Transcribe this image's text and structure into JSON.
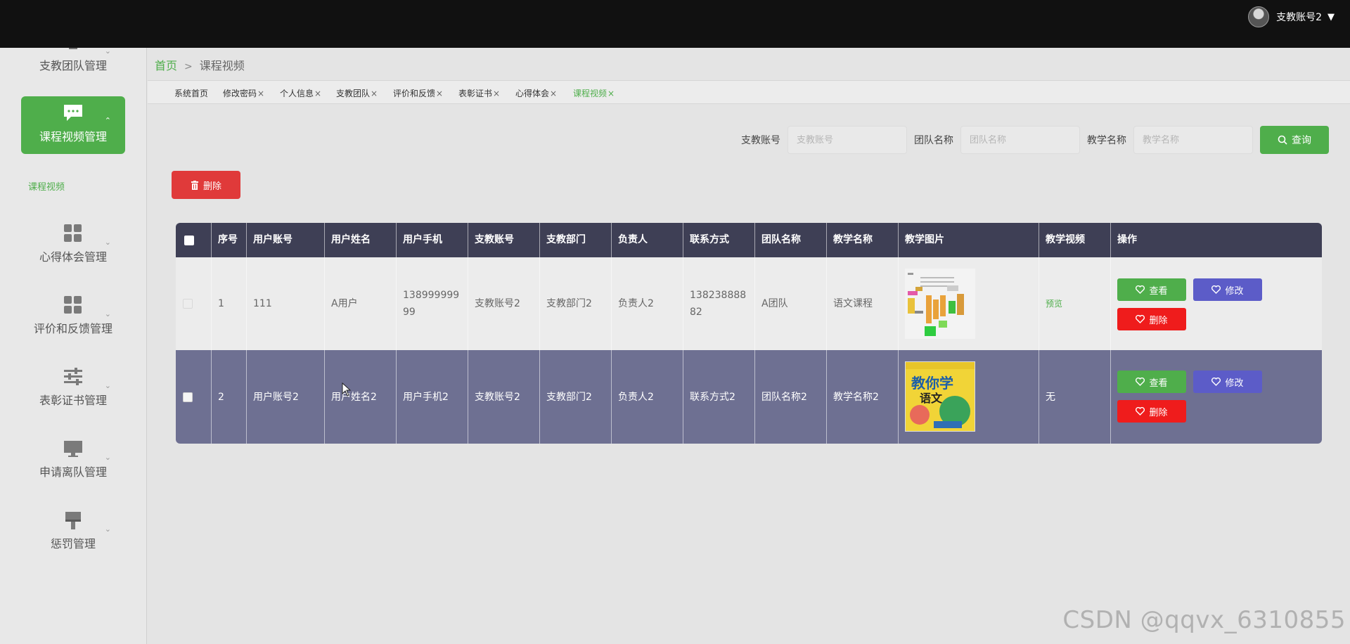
{
  "header": {
    "username": "支教账号2",
    "caret": "▼"
  },
  "sidebar": {
    "items": [
      {
        "label": "支教团队管理",
        "icon": "team-icon"
      },
      {
        "label": "课程视频管理",
        "icon": "chat-icon",
        "active": true
      },
      {
        "label": "心得体会管理",
        "icon": "grid-icon"
      },
      {
        "label": "评价和反馈管理",
        "icon": "grid-icon"
      },
      {
        "label": "表彰证书管理",
        "icon": "sliders-icon"
      },
      {
        "label": "申请离队管理",
        "icon": "monitor-icon"
      },
      {
        "label": "惩罚管理",
        "icon": "brush-icon"
      }
    ],
    "sub_item": "课程视频"
  },
  "breadcrumb": {
    "home": "首页",
    "separator": ">",
    "current": "课程视频"
  },
  "tags": [
    {
      "label": "系统首页",
      "close": ""
    },
    {
      "label": "修改密码",
      "close": "×"
    },
    {
      "label": "个人信息",
      "close": "×"
    },
    {
      "label": "支教团队",
      "close": "×"
    },
    {
      "label": "评价和反馈",
      "close": "×"
    },
    {
      "label": "表彰证书",
      "close": "×"
    },
    {
      "label": "心得体会",
      "close": "×"
    },
    {
      "label": "课程视频",
      "close": "×",
      "active": true
    }
  ],
  "search": {
    "fields": [
      {
        "label": "支教账号",
        "placeholder": "支教账号",
        "value": ""
      },
      {
        "label": "团队名称",
        "placeholder": "团队名称",
        "value": ""
      },
      {
        "label": "教学名称",
        "placeholder": "教学名称",
        "value": ""
      }
    ],
    "query_label": "查询"
  },
  "toolbar": {
    "delete_label": "删除"
  },
  "table": {
    "headers": [
      "序号",
      "用户账号",
      "用户姓名",
      "用户手机",
      "支教账号",
      "支教部门",
      "负责人",
      "联系方式",
      "团队名称",
      "教学名称",
      "教学图片",
      "教学视频",
      "操作"
    ],
    "rows": [
      {
        "index": "1",
        "account": "111",
        "name": "A用户",
        "phone": "138999999\n99",
        "teach_account": "支教账号2",
        "dept": "支教部门2",
        "leader": "负责人2",
        "contact": "138238888\n82",
        "team": "A团队",
        "course": "语文课程",
        "video": "预览"
      },
      {
        "index": "2",
        "account": "用户账号2",
        "name": "用户姓名2",
        "phone": "用户手机2",
        "teach_account": "支教账号2",
        "dept": "支教部门2",
        "leader": "负责人2",
        "contact": "联系方式2",
        "team": "团队名称2",
        "course": "教学名称2",
        "video": "无"
      }
    ],
    "actions": {
      "view": "查看",
      "edit": "修改",
      "delete": "删除"
    }
  },
  "book_cover": {
    "title": "教你学",
    "subtitle": "语文"
  },
  "watermark": "CSDN @qqvx_6310855",
  "colors": {
    "accent": "#4fae4b",
    "danger": "#e03a3a",
    "edit": "#5c5cc8",
    "header_bg": "#3e3f55",
    "selected_row": "#6e7092"
  }
}
